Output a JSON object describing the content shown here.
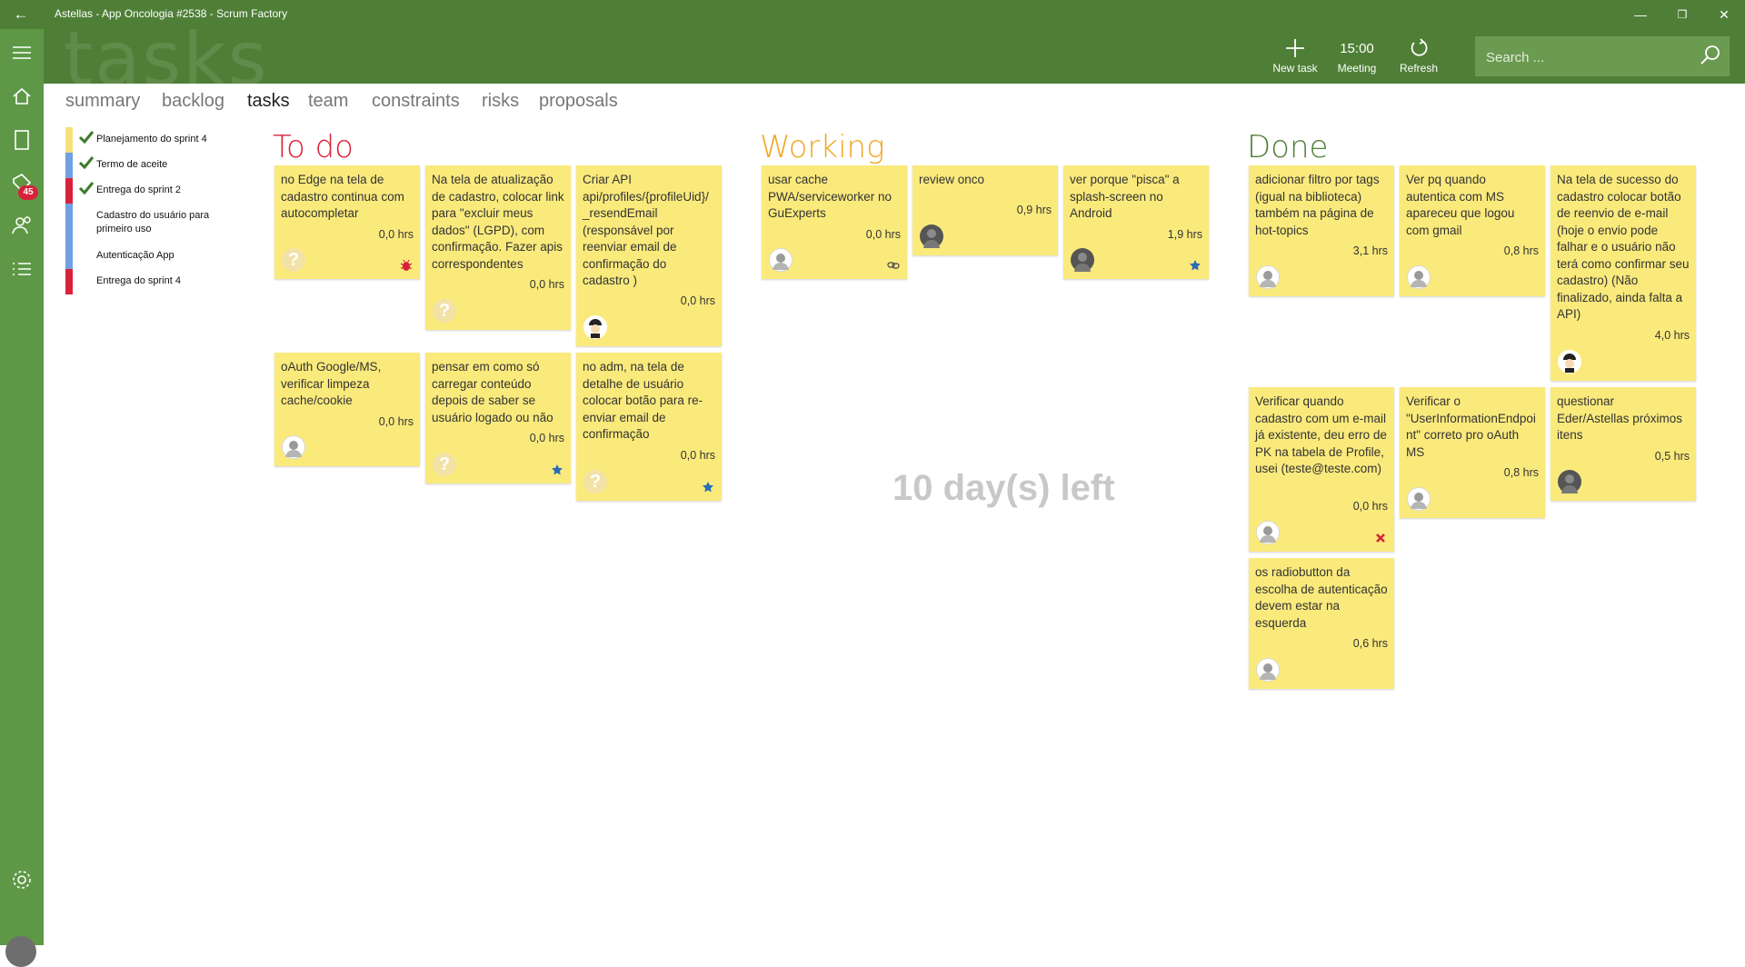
{
  "window": {
    "title": "Astellas - App Oncologia #2538 - Scrum Factory"
  },
  "header": {
    "watermark_title": "tasks",
    "new_task_label": "New task",
    "meeting_time": "15:00",
    "meeting_label": "Meeting",
    "refresh_label": "Refresh",
    "search_placeholder": "Search ..."
  },
  "rail": {
    "badge_count": "45"
  },
  "tabs": [
    "summary",
    "backlog",
    "tasks",
    "team",
    "constraints",
    "risks",
    "proposals"
  ],
  "active_tab": "tasks",
  "backlog": [
    {
      "label": "Planejamento do sprint 4",
      "color": "#f4e17a",
      "done": true
    },
    {
      "label": "Termo de aceite",
      "color": "#6fa0e0",
      "done": true
    },
    {
      "label": "Entrega do sprint 2",
      "color": "#d8223a",
      "done": true
    },
    {
      "label": "Cadastro do usuário para primeiro uso",
      "color": "#6fa0e0",
      "done": false
    },
    {
      "label": "Autenticação App",
      "color": "#6fa0e0",
      "done": false
    },
    {
      "label": "Entrega do sprint 4",
      "color": "#d8223a",
      "done": false
    }
  ],
  "columns": {
    "todo": {
      "title": "To do",
      "color": "#d8223a"
    },
    "working": {
      "title": "Working",
      "color": "#f0a71f"
    },
    "done": {
      "title": "Done",
      "color": "#4f7f37"
    }
  },
  "cards": {
    "todo": [
      {
        "text": "no Edge na tela de cadastro continua com autocompletar",
        "hours": "0,0 hrs",
        "avatar": "unknown",
        "mark": "bug-icon"
      },
      {
        "text": "Na tela de atualização de cadastro, colocar link para \"excluir meus dados\" (LGPD), com confirmação. Fazer apis correspondentes",
        "hours": "0,0 hrs",
        "avatar": "unknown",
        "mark": ""
      },
      {
        "text": "Criar API api/profiles/{profileUid}/_resendEmail (responsável por reenviar email de confirmação do cadastro )",
        "hours": "0,0 hrs",
        "avatar": "cartoon",
        "mark": ""
      },
      {
        "text": "oAuth Google/MS, verificar limpeza cache/cookie",
        "hours": "0,0 hrs",
        "avatar": "photo",
        "mark": ""
      },
      {
        "text": "pensar em como só carregar conteúdo depois de saber se usuário logado ou não",
        "hours": "0,0 hrs",
        "avatar": "unknown",
        "mark": "star-icon"
      },
      {
        "text": "no adm, na tela de detalhe de usuário colocar botão para re-enviar email de confirmação",
        "hours": "0,0 hrs",
        "avatar": "unknown",
        "mark": "star-icon"
      }
    ],
    "working": [
      {
        "text": "usar cache PWA/serviceworker no GuExperts",
        "hours": "0,0 hrs",
        "avatar": "photo",
        "mark": "link-icon"
      },
      {
        "text": "review onco",
        "hours": "0,9 hrs",
        "avatar": "dark",
        "mark": ""
      },
      {
        "text": "ver porque \"pisca\" a splash-screen no Android",
        "hours": "1,9 hrs",
        "avatar": "dark",
        "mark": "star-icon"
      }
    ],
    "done": [
      {
        "text": "adicionar filtro por tags (igual na biblioteca) também na página de hot-topics",
        "hours": "3,1 hrs",
        "avatar": "photo",
        "mark": ""
      },
      {
        "text": "Ver pq quando autentica com MS apareceu que logou com gmail",
        "hours": "0,8 hrs",
        "avatar": "photo",
        "mark": ""
      },
      {
        "text": "Na tela de sucesso do cadastro colocar botão de reenvio de e-mail (hoje o envio pode falhar e o usuário não terá como confirmar seu cadastro) (Não finalizado, ainda falta a API)",
        "hours": "4,0 hrs",
        "avatar": "cartoon",
        "mark": ""
      },
      {
        "text": "Verificar quando cadastro com um e-mail já existente, deu erro de PK na tabela de Profile, usei (teste@teste.com)",
        "hours": "0,0 hrs",
        "avatar": "photo",
        "mark": "x-icon"
      },
      {
        "text": "Verificar o \"UserInformationEndpoint\" correto pro oAuth MS",
        "hours": "0,8 hrs",
        "avatar": "photo",
        "mark": ""
      },
      {
        "text": "questionar Eder/Astellas próximos itens",
        "hours": "0,5 hrs",
        "avatar": "dark",
        "mark": ""
      },
      {
        "text": "os radiobutton da escolha de autenticação devem estar na esquerda",
        "hours": "0,6 hrs",
        "avatar": "photo",
        "mark": ""
      }
    ]
  },
  "days_left": "10 day(s) left"
}
